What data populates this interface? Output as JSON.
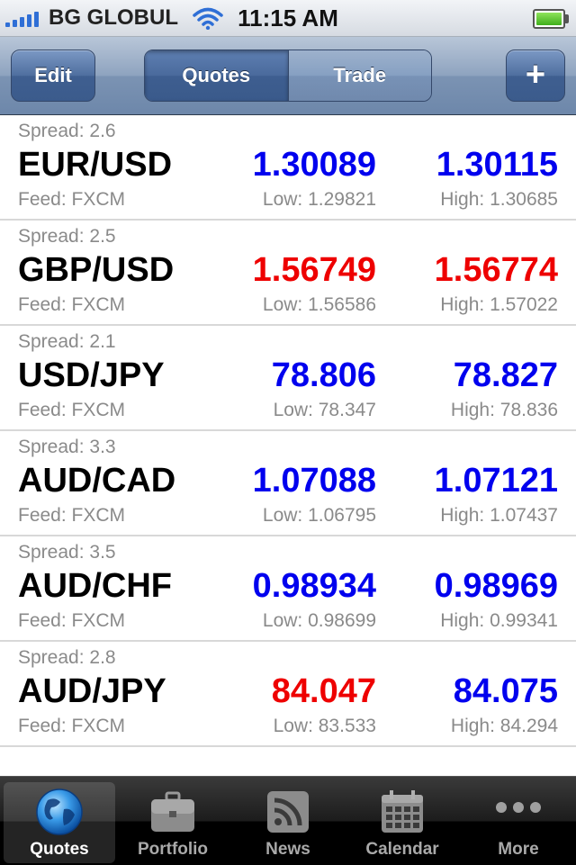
{
  "status_bar": {
    "carrier": "BG GLOBUL",
    "time": "11:15 AM",
    "battery_level": 1.0
  },
  "nav": {
    "edit_label": "Edit",
    "segments": [
      "Quotes",
      "Trade"
    ],
    "active_segment": "Quotes",
    "add_label": "+"
  },
  "colors": {
    "up": "#0000ee",
    "down": "#ee0000",
    "muted": "#8a8a8a"
  },
  "quotes": [
    {
      "spread": "Spread: 2.6",
      "symbol": "EUR/USD",
      "feed": "Feed: FXCM",
      "bid": "1.30089",
      "ask": "1.30115",
      "low": "Low: 1.29821",
      "high": "High: 1.30685",
      "direction": "up"
    },
    {
      "spread": "Spread: 2.5",
      "symbol": "GBP/USD",
      "feed": "Feed: FXCM",
      "bid": "1.56749",
      "ask": "1.56774",
      "low": "Low: 1.56586",
      "high": "High: 1.57022",
      "direction": "down"
    },
    {
      "spread": "Spread: 2.1",
      "symbol": "USD/JPY",
      "feed": "Feed: FXCM",
      "bid": "78.806",
      "ask": "78.827",
      "low": "Low: 78.347",
      "high": "High: 78.836",
      "direction": "up"
    },
    {
      "spread": "Spread: 3.3",
      "symbol": "AUD/CAD",
      "feed": "Feed: FXCM",
      "bid": "1.07088",
      "ask": "1.07121",
      "low": "Low: 1.06795",
      "high": "High: 1.07437",
      "direction": "up"
    },
    {
      "spread": "Spread: 3.5",
      "symbol": "AUD/CHF",
      "feed": "Feed: FXCM",
      "bid": "0.98934",
      "ask": "0.98969",
      "low": "Low: 0.98699",
      "high": "High: 0.99341",
      "direction": "up"
    },
    {
      "spread": "Spread: 2.8",
      "symbol": "AUD/JPY",
      "feed": "Feed: FXCM",
      "bid": "84.047",
      "ask": "84.075",
      "low": "Low: 83.533",
      "high": "High: 84.294",
      "direction": "mixed"
    }
  ],
  "tabs": [
    {
      "label": "Quotes",
      "icon": "globe-icon",
      "active": true
    },
    {
      "label": "Portfolio",
      "icon": "briefcase-icon",
      "active": false
    },
    {
      "label": "News",
      "icon": "rss-icon",
      "active": false
    },
    {
      "label": "Calendar",
      "icon": "calendar-icon",
      "active": false
    },
    {
      "label": "More",
      "icon": "more-dots-icon",
      "active": false
    }
  ]
}
